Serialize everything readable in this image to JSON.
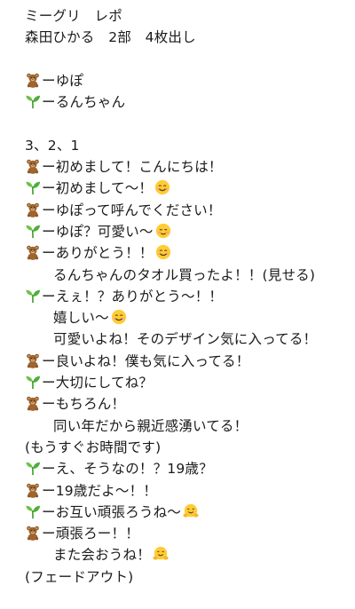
{
  "lines": [
    {
      "text": "ミーグリ　レポ"
    },
    {
      "text": "森田ひかる　2部　4枚出し"
    },
    {
      "text": ""
    },
    {
      "icon": "bear-icon",
      "text": "ーゆぽ"
    },
    {
      "icon": "seedling-icon",
      "text": "ーるんちゃん"
    },
    {
      "text": ""
    },
    {
      "text": "3、2、1"
    },
    {
      "icon": "bear-icon",
      "text": "ー初めまして！こんにちは！"
    },
    {
      "icon": "seedling-icon",
      "text": "ー初めまして〜！",
      "end_icon": "smiling-face-icon"
    },
    {
      "icon": "bear-icon",
      "text": "ーゆぽって呼んでください！"
    },
    {
      "icon": "seedling-icon",
      "text": "ーゆぽ？可愛い〜",
      "end_icon": "relieved-face-icon"
    },
    {
      "icon": "bear-icon",
      "text": "ーありがとう！！",
      "end_icon": "smiling-face-icon"
    },
    {
      "indent": true,
      "text": "るんちゃんのタオル買ったよ！！(見せる)"
    },
    {
      "icon": "seedling-icon",
      "text": "ーえぇ！？ありがとう〜！！"
    },
    {
      "indent": true,
      "text": "嬉しい〜",
      "end_icon": "smiling-face-icon"
    },
    {
      "indent": true,
      "text": "可愛いよね！そのデザイン気に入ってる！"
    },
    {
      "icon": "bear-icon",
      "text": "ー良いよね！僕も気に入ってる！"
    },
    {
      "icon": "seedling-icon",
      "text": "ー大切にしてね？"
    },
    {
      "icon": "bear-icon",
      "text": "ーもちろん！"
    },
    {
      "indent": true,
      "text": "同い年だから親近感湧いてる！"
    },
    {
      "text": "(もうすぐお時間です)"
    },
    {
      "icon": "seedling-icon",
      "text": "ーえ、そうなの！？19歳？"
    },
    {
      "icon": "bear-icon",
      "text": "ー19歳だよ〜！！"
    },
    {
      "icon": "seedling-icon",
      "text": "ーお互い頑張ろうね〜",
      "end_icon": "hugging-face-icon"
    },
    {
      "icon": "bear-icon",
      "text": "ー頑張ろー！！"
    },
    {
      "indent": true,
      "text": "また会おうね！",
      "end_icon": "hugging-face-icon"
    },
    {
      "text": "(フェードアウト)"
    }
  ],
  "icons": {
    "bear-icon": "🧸",
    "seedling-icon": "🌱",
    "smiling-face-icon": "😊",
    "relieved-face-icon": "☺️",
    "hugging-face-icon": "🤗"
  },
  "colors": {
    "text": "#1a1a1a",
    "background": "#ffffff"
  }
}
